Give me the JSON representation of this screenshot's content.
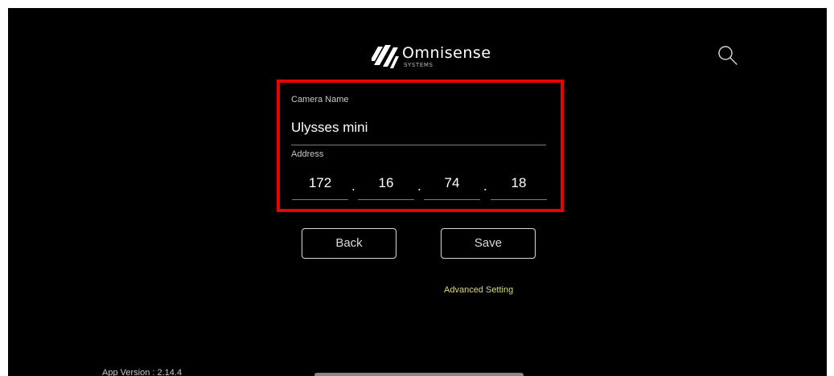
{
  "brand": {
    "name": "Omnisense",
    "sub": "SYSTEMS"
  },
  "form": {
    "camera_name_label": "Camera Name",
    "camera_name_value": "Ulysses mini",
    "address_label": "Address",
    "ip": [
      "172",
      "16",
      "74",
      "18"
    ],
    "dot": "."
  },
  "buttons": {
    "back": "Back",
    "save": "Save"
  },
  "advanced_link": "Advanced Setting",
  "footer": {
    "version": "App Version : 2.14.4"
  },
  "colors": {
    "highlight": "#ee0000",
    "advanced": "#d9d97a",
    "background": "#000000"
  },
  "icons": {
    "search": "search-icon",
    "logo": "omnisense-logo-mark"
  }
}
